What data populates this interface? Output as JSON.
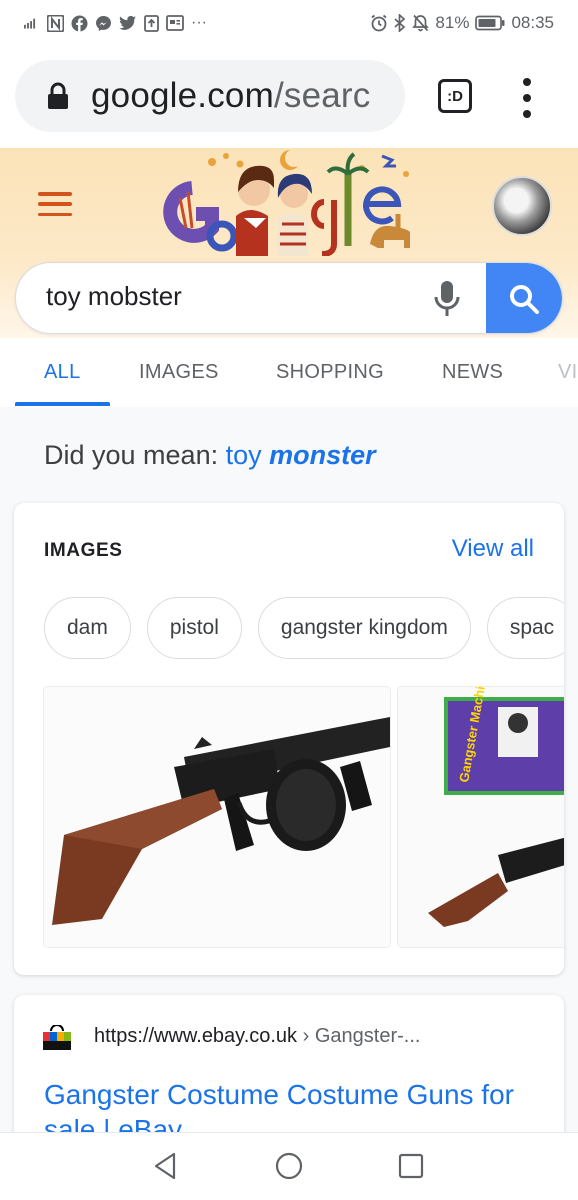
{
  "status_bar": {
    "battery": "81%",
    "time": "08:35"
  },
  "chrome": {
    "url_host": "google.com",
    "url_path": "/searc",
    "tab_switcher_label": ":D"
  },
  "search": {
    "query": "toy mobster"
  },
  "tabs": [
    {
      "label": "ALL"
    },
    {
      "label": "IMAGES"
    },
    {
      "label": "SHOPPING"
    },
    {
      "label": "NEWS"
    },
    {
      "label": "VI"
    }
  ],
  "did_you_mean": {
    "prefix": "Did you mean:",
    "plain": "toy",
    "emph": "monster"
  },
  "images_card": {
    "heading": "IMAGES",
    "view_all": "View all",
    "chips": [
      "dam",
      "pistol",
      "gangster kingdom",
      "spac"
    ],
    "thumb2_text": "Gangster Machine Gun"
  },
  "result": {
    "url": "https://www.ebay.co.uk",
    "crumb": " › Gangster-...",
    "title": "Gangster Costume Costume Guns for sale | eBay"
  },
  "colors": {
    "accent": "#1a73e8",
    "search_button": "#4285f4",
    "doodle_bg": "#fbe3b8",
    "menu_orange": "#d2541c"
  },
  "icons": [
    "lock-icon",
    "tab-switcher-icon",
    "overflow-menu-icon",
    "hamburger-icon",
    "mic-icon",
    "search-icon",
    "back-icon",
    "home-icon",
    "recents-icon"
  ]
}
